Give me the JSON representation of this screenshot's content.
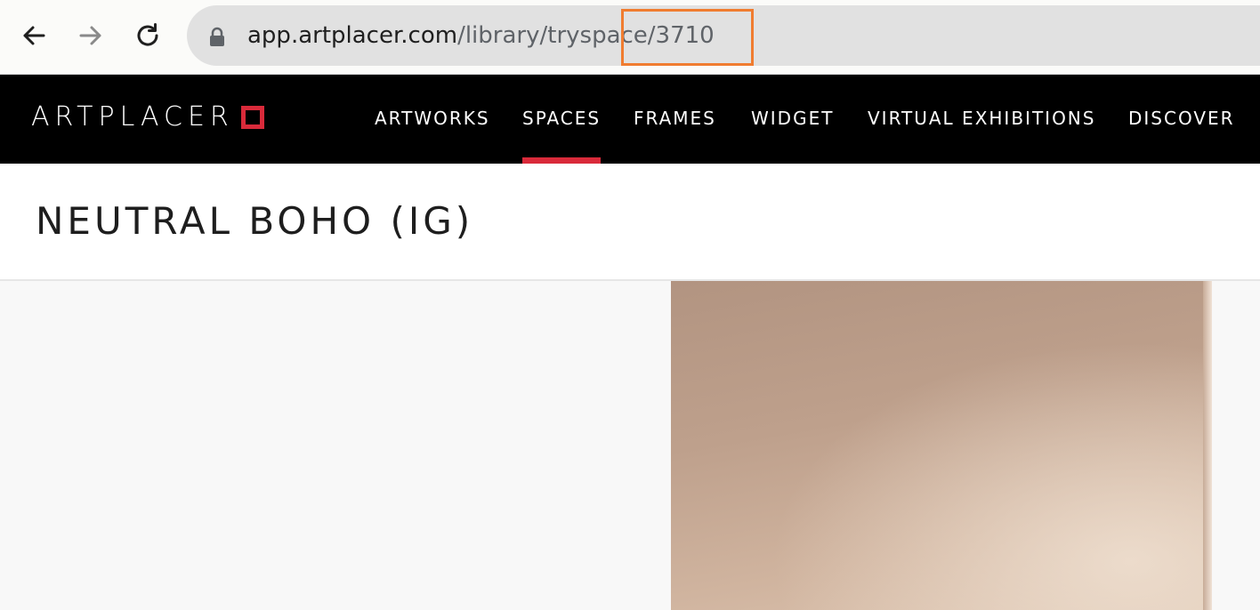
{
  "browser": {
    "url_domain": "app.artplacer.com",
    "url_path": "/library/tryspace/3710"
  },
  "site": {
    "logo_text": "ARTPLACER",
    "brand_color": "#d92a3a",
    "nav": [
      {
        "label": "ARTWORKS",
        "active": false
      },
      {
        "label": "SPACES",
        "active": true
      },
      {
        "label": "FRAMES",
        "active": false
      },
      {
        "label": "WIDGET",
        "active": false
      },
      {
        "label": "VIRTUAL EXHIBITIONS",
        "active": false
      },
      {
        "label": "DISCOVER",
        "active": false
      }
    ]
  },
  "page": {
    "title": "NEUTRAL BOHO (IG)"
  },
  "annotation": {
    "highlight_color": "#f07c30"
  }
}
